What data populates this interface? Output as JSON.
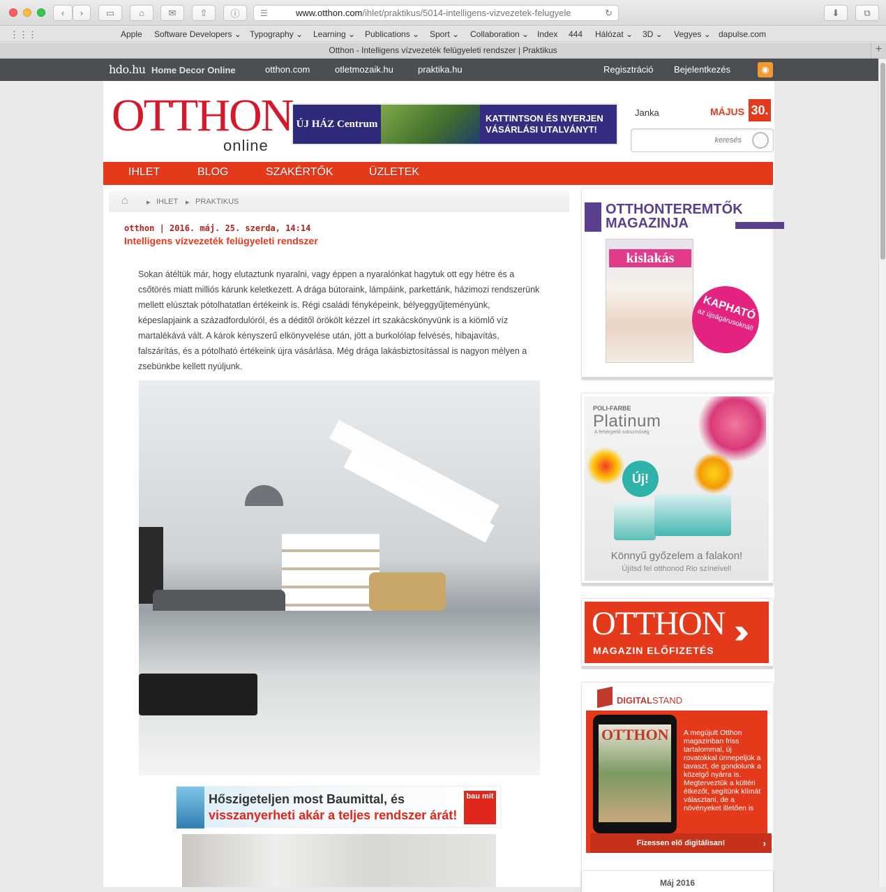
{
  "browser": {
    "url_host": "www.otthon.com",
    "url_path": "/ihlet/praktikus/5014-intelligens-vizvezetek-felugyele",
    "tab_title": "Otthon - Intelligens vízvezeték felügyeleti rendszer | Praktikus",
    "bookmarks": [
      "Apple",
      "Software Developers ⌄",
      "Typography ⌄",
      "Learning ⌄",
      "Publications ⌄",
      "Sport ⌄",
      "Collaboration ⌄",
      "Index",
      "444",
      "Hálózat ⌄",
      "3D ⌄",
      "Vegyes ⌄",
      "dapulse.com"
    ]
  },
  "sitebar": {
    "brand": "hdo.hu",
    "brand_sub": "Home Decor Online",
    "links": [
      "otthon.com",
      "otletmozaik.hu",
      "praktika.hu"
    ],
    "register": "Regisztráció",
    "login": "Bejelentkezés"
  },
  "header": {
    "logo_main": "OTTHON",
    "logo_sub": "online",
    "ad_left": "ÚJ HÁZ Centrum",
    "ad_right": "KATTINTSON ÉS NYERJEN VÁSÁRLÁSI UTALVÁNYT!",
    "user": "Janka",
    "month": "MÁJUS",
    "day": "30.",
    "search_placeholder": "keresés"
  },
  "nav": [
    "IHLET",
    "BLOG",
    "SZAKÉRTŐK",
    "ÜZLETEK"
  ],
  "article": {
    "breadcrumb": [
      "IHLET",
      "PRAKTIKUS"
    ],
    "meta": "otthon | 2016. máj. 25. szerda, 14:14",
    "title": "Intelligens vízvezeték felügyeleti rendszer",
    "lead": "Sokan átéltük már, hogy elutaztunk nyaralni, vagy éppen a nyaralónkat hagytuk ott egy hétre és a csőtörés miatt milliós kárunk keletkezett. A drága bútoraink, lámpáink, parkettánk, házimozi rendszerünk mellett elúsztak pótolhatatlan értékeink is. Régi családi fényképeink, bélyeggyűjteményünk, képeslapjaink a századfordulóról, és a déditől örökölt kézzel írt szakácskönyvünk is a kiömlő víz martalékává vált. A károk kényszerű elkönyvelése után, jött a burkolólap felvésés, hibajavítás, falszárítás, és a pótolható értékeink újra vásárlása. Még drága lakásbiztosítással is nagyon mélyen a zsebünkbe kellett nyúljunk.",
    "ad_line1": "Hőszigeteljen most Baumittal, és",
    "ad_line2": "visszanyerheti akár a teljes rendszer árát!",
    "ad_brand": "bau mit"
  },
  "sidebar": {
    "mag_title1": "OTTHONTEREMTŐK",
    "mag_title2": "MAGAZINJA",
    "mag_name": "kislakás",
    "mag_bubble": "KAPHATÓ",
    "mag_bubble_sub": "az újságárusoknál!",
    "paint_brand1": "POLI-FARBE",
    "paint_brand2": "Platinum",
    "paint_tag": "A fehérgerlő sokszínűség",
    "paint_new": "Új!",
    "paint_line1": "Könnyű győzelem a falakon!",
    "paint_line2": "Újítsd fel otthonod Rio színeivel!",
    "sub_big": "OTTHON",
    "sub_small": "MAGAZIN ELŐFIZETÉS",
    "ds_a": "DIGITAL",
    "ds_b": "STAND",
    "ds_screen": "OTTHON",
    "ds_text": "A megújult Otthon magazinban friss tartalommal, új rovatokkal ünnepeljük a tavaszt, de gondolunk a közelgő nyárra is. Megterveztük a kültéri étkezőt, segítünk klímát választani, de a növényeket illetően is",
    "ds_button": "Fizessen elő digitálisan!",
    "calendar": "Máj 2016"
  }
}
